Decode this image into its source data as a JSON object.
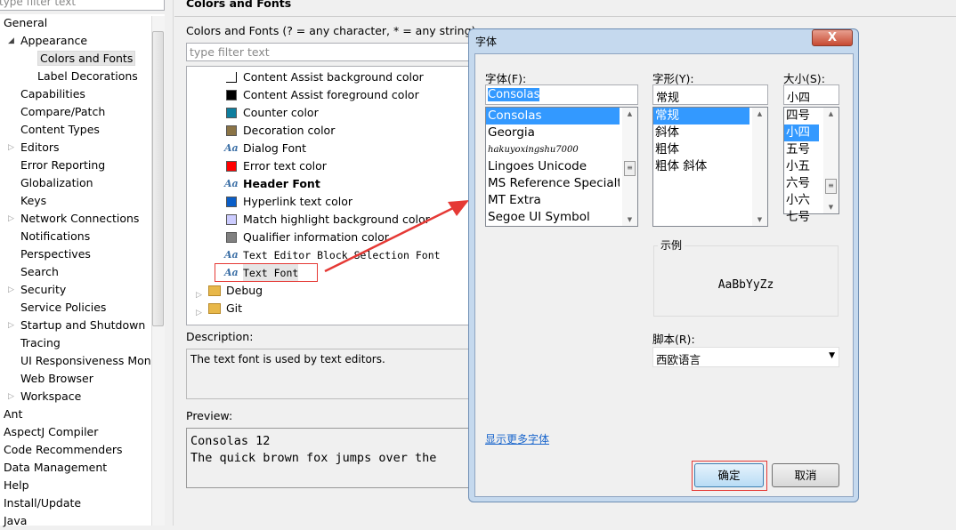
{
  "sidebar": {
    "filter_placeholder": "type filter text",
    "items": [
      {
        "label": "General",
        "level": 0
      },
      {
        "label": "Appearance",
        "level": 1,
        "expander": "expanded"
      },
      {
        "label": "Colors and Fonts",
        "level": 2,
        "selected": true
      },
      {
        "label": "Label Decorations",
        "level": 2
      },
      {
        "label": "Capabilities",
        "level": 1
      },
      {
        "label": "Compare/Patch",
        "level": 1
      },
      {
        "label": "Content Types",
        "level": 1
      },
      {
        "label": "Editors",
        "level": 1,
        "expander": "collapsed"
      },
      {
        "label": "Error Reporting",
        "level": 1
      },
      {
        "label": "Globalization",
        "level": 1
      },
      {
        "label": "Keys",
        "level": 1
      },
      {
        "label": "Network Connections",
        "level": 1,
        "expander": "collapsed"
      },
      {
        "label": "Notifications",
        "level": 1
      },
      {
        "label": "Perspectives",
        "level": 1
      },
      {
        "label": "Search",
        "level": 1
      },
      {
        "label": "Security",
        "level": 1,
        "expander": "collapsed"
      },
      {
        "label": "Service Policies",
        "level": 1
      },
      {
        "label": "Startup and Shutdown",
        "level": 1,
        "expander": "collapsed"
      },
      {
        "label": "Tracing",
        "level": 1
      },
      {
        "label": "UI Responsiveness Monit",
        "level": 1
      },
      {
        "label": "Web Browser",
        "level": 1
      },
      {
        "label": "Workspace",
        "level": 1,
        "expander": "collapsed"
      },
      {
        "label": "Ant",
        "level": 0
      },
      {
        "label": "AspectJ Compiler",
        "level": 0
      },
      {
        "label": "Code Recommenders",
        "level": 0
      },
      {
        "label": "Data Management",
        "level": 0
      },
      {
        "label": "Help",
        "level": 0
      },
      {
        "label": "Install/Update",
        "level": 0
      },
      {
        "label": "Java",
        "level": 0
      }
    ]
  },
  "main": {
    "title": "Colors and Fonts",
    "filter_label": "Colors and Fonts (? = any character, * = any string):",
    "filter_placeholder": "type filter text",
    "tree": [
      {
        "label": "Content Assist background color",
        "kind": "color",
        "color": "#ffffff"
      },
      {
        "label": "Content Assist foreground color",
        "kind": "color",
        "color": "#000000"
      },
      {
        "label": "Counter color",
        "kind": "color",
        "color": "#0e7e9e"
      },
      {
        "label": "Decoration color",
        "kind": "color",
        "color": "#8b7446"
      },
      {
        "label": "Dialog Font",
        "kind": "font"
      },
      {
        "label": "Error text color",
        "kind": "color",
        "color": "#ff0000"
      },
      {
        "label": "Header Font",
        "kind": "font",
        "bold": true
      },
      {
        "label": "Hyperlink text color",
        "kind": "color",
        "color": "#0a5ec8"
      },
      {
        "label": "Match highlight background color",
        "kind": "color",
        "color": "#ccccff"
      },
      {
        "label": "Qualifier information color",
        "kind": "color",
        "color": "#808080"
      },
      {
        "label": "Text Editor Block Selection Font",
        "kind": "font",
        "mono": true
      },
      {
        "label": "Text Font",
        "kind": "font",
        "mono": true,
        "highlighted": true
      },
      {
        "label": "Debug",
        "kind": "folder"
      },
      {
        "label": "Git",
        "kind": "folder"
      }
    ],
    "description_label": "Description:",
    "description": "The text font is used by text editors.",
    "preview_label": "Preview:",
    "preview_line1": "Consolas 12",
    "preview_line2": "The quick brown fox jumps over the"
  },
  "dialog": {
    "title": "字体",
    "close": "X",
    "font_label": "字体(F):",
    "font_value": "Consolas",
    "fonts": [
      "Consolas",
      "Georgia",
      "hakuyoxingshu7000",
      "Lingoes Unicode",
      "MS Reference Specialt",
      "MT Extra",
      "Segoe UI Symbol"
    ],
    "style_label": "字形(Y):",
    "style_value": "常规",
    "styles": [
      "常规",
      "斜体",
      "粗体",
      "粗体 斜体"
    ],
    "size_label": "大小(S):",
    "size_value": "小四",
    "sizes": [
      "四号",
      "小四",
      "五号",
      "小五",
      "六号",
      "小六",
      "七号"
    ],
    "sample_label": "示例",
    "sample_text": "AaBbYyZz",
    "script_label": "脚本(R):",
    "script_value": "西欧语言",
    "more_fonts_link": "显示更多字体",
    "ok": "确定",
    "cancel": "取消"
  },
  "annotation_color": "#e53935"
}
